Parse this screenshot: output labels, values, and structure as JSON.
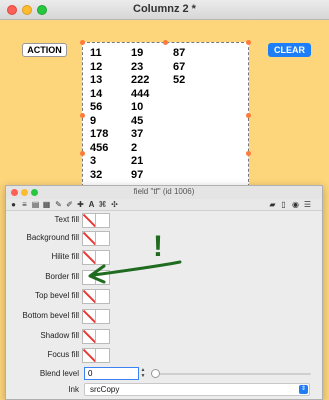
{
  "window": {
    "title": "Columnz 2 *"
  },
  "buttons": {
    "action_label": "ACTION",
    "clear_label": "CLEAR"
  },
  "field": {
    "columns": [
      [
        "11",
        "12",
        "13",
        "14",
        "56",
        "9",
        "178",
        "456",
        "3",
        "32"
      ],
      [
        "19",
        "23",
        "222",
        "444",
        "10",
        "45",
        "37",
        "2",
        "21",
        "97"
      ],
      [
        "87",
        "67",
        "52"
      ]
    ]
  },
  "inspector": {
    "title": "field \"tf\" (id 1006)",
    "toolbar_icons": [
      "info-icon",
      "list-icon",
      "database-icon",
      "table-icon",
      "pencil-icon",
      "brush-icon",
      "plus-icon",
      "text-icon",
      "link-icon",
      "gear-icon",
      "lock-icon",
      "document-icon",
      "globe-icon",
      "menu-icon"
    ],
    "properties": [
      {
        "label": "Text fill"
      },
      {
        "label": "Background fill"
      },
      {
        "label": "Hilite fill"
      },
      {
        "label": "Border fill"
      },
      {
        "label": "Top bevel fill"
      },
      {
        "label": "Bottom bevel fill"
      },
      {
        "label": "Shadow fill"
      },
      {
        "label": "Focus fill"
      }
    ],
    "blend": {
      "label": "Blend level",
      "value": "0"
    },
    "ink": {
      "label": "Ink",
      "value": "srcCopy"
    }
  },
  "annotation": {
    "mark": "!",
    "color": "#1f6b1f"
  }
}
